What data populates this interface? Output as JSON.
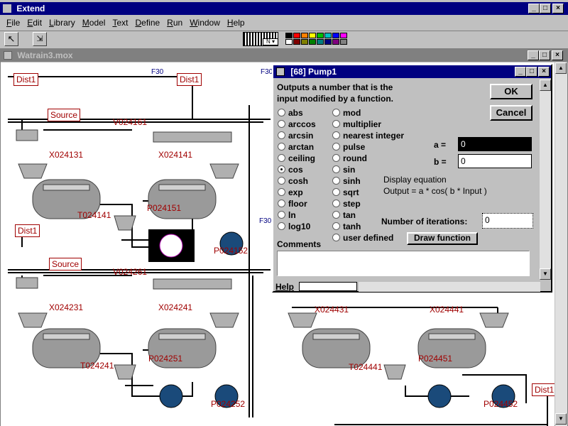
{
  "app": {
    "title": "Extend"
  },
  "menu": [
    "File",
    "Edit",
    "Library",
    "Model",
    "Text",
    "Define",
    "Run",
    "Window",
    "Help"
  ],
  "palette": [
    "#000000",
    "#ff0000",
    "#ff8000",
    "#ffff00",
    "#00c000",
    "#00c0c0",
    "#0000ff",
    "#ff00ff",
    "#ffffff",
    "#800000",
    "#808000",
    "#008000",
    "#008080",
    "#000080",
    "#800080",
    "#808080"
  ],
  "model_window": {
    "title": "Watrain3.mox"
  },
  "model": {
    "dist_labels": [
      "Dist1",
      "Dist1",
      "Dist1",
      "Dist1"
    ],
    "source_labels": [
      "Source",
      "Source"
    ],
    "flow_labels": [
      "F30",
      "F30",
      "F30"
    ],
    "blocks": [
      "V024161",
      "X024131",
      "X024141",
      "T024141",
      "P024151",
      "P024152",
      "V024261",
      "X024231",
      "X024241",
      "T024241",
      "P024251",
      "P024252",
      "X024431",
      "X024441",
      "T024441",
      "P024451",
      "P024452"
    ]
  },
  "dialog": {
    "title": "[68]  Pump1",
    "description_line1": "Outputs a number that is the",
    "description_line2": "input modified by a function.",
    "ok": "OK",
    "cancel": "Cancel",
    "functions_col1": [
      "abs",
      "arccos",
      "arcsin",
      "arctan",
      "ceiling",
      "cos",
      "cosh",
      "exp",
      "floor",
      "ln",
      "log10"
    ],
    "functions_col2": [
      "mod",
      "multiplier",
      "nearest integer",
      "pulse",
      "round",
      "sin",
      "sinh",
      "sqrt",
      "step",
      "tan",
      "tanh",
      "user defined"
    ],
    "selected": "cos",
    "a_label": "a =",
    "a_value": "0",
    "b_label": "b =",
    "b_value": "0",
    "equation_title": "Display equation",
    "equation": "Output = a * cos( b * Input )",
    "iterations_label": "Number of iterations:",
    "iterations_value": "0",
    "draw_button": "Draw function",
    "comments_label": "Comments",
    "help": "Help"
  }
}
